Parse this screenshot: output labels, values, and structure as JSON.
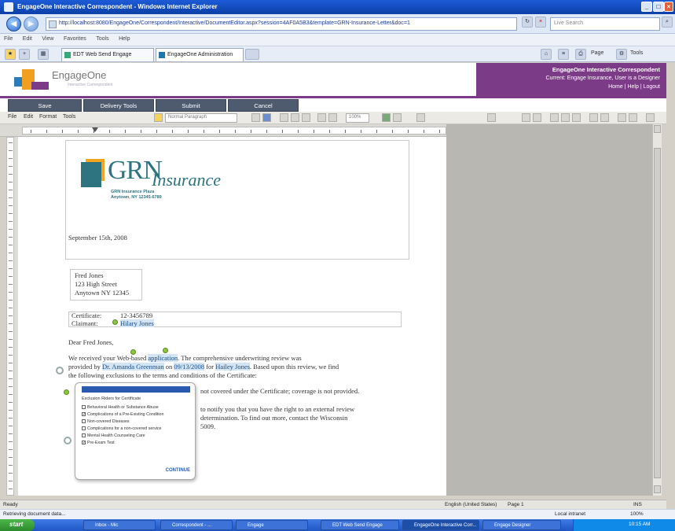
{
  "window": {
    "title": "EngageOne Interactive Correspondent - Windows Internet Explorer"
  },
  "browser": {
    "address": "http://localhost:8080/EngageOne/Correspondent/Interactive/DocumentEditor.aspx?session=4AF0A5B3&template=GRN-Insurance-Letter&doc=1",
    "search_placeholder": "Live Search",
    "menu": [
      "File",
      "Edit",
      "View",
      "Favorites",
      "Tools",
      "Help"
    ],
    "tabs": [
      {
        "label": "EDT Web Send Engage"
      },
      {
        "label": "EngageOne Administration"
      }
    ],
    "toolbar_labels": {
      "page": "Page",
      "tools": "Tools"
    }
  },
  "app": {
    "name": "EngageOne",
    "subtitle": "Interactive Correspondent",
    "banner_title": "EngageOne Interactive Correspondent",
    "banner_line2": "Current: Engage Insurance, User is a Designer",
    "banner_links": "Home | Help | Logout",
    "actions": [
      "Save",
      "Delivery Tools",
      "Submit",
      "Cancel"
    ]
  },
  "editor": {
    "menu": [
      "File",
      "Edit",
      "Format",
      "Tools"
    ],
    "style_select": "Normal Paragraph",
    "zoom": "100%"
  },
  "letter": {
    "brand_big": "GRN",
    "brand_small": "Insurance",
    "brand_addr1": "GRN Insurance Plaza",
    "brand_addr2": "Anytown, NY 12345-6789",
    "date": "September 15th, 2008",
    "recipient": [
      "Fred Jones",
      "123 High Street",
      "Anytown NY 12345"
    ],
    "certificate_label": "Certificate:",
    "certificate_value": "12-3456789",
    "claimant_label": "Claimant:",
    "claimant_value": "Hilary Jones",
    "salutation": "Dear Fred Jones,",
    "para1_a": "We received your Web-based",
    "para1_link": "application",
    "para1_b": ". The comprehensive underwriting review was",
    "para2_a": "provided by",
    "para2_link1": "Dr. Amanda Greenman",
    "para2_b": " on",
    "para2_link2": "09/13/2008",
    "para2_c": " for",
    "para2_link3": "Hailey Jones",
    "para2_d": ". Based upon this review, we find",
    "para3": "the following exclusions to the terms and conditions of the Certificate:",
    "para4": "not covered under the Certificate; coverage is not provided.",
    "para5": "to notify you that you have the right to an external review",
    "para6": "determination. To find out more, contact the Wisconsin",
    "para7": "5009."
  },
  "popup": {
    "title": "Exclusion Riders for Certificate",
    "options": [
      {
        "label": "Behavioral Health or Substance Abuse",
        "checked": false
      },
      {
        "label": "Complications of a Pre-Existing Condition",
        "checked": true
      },
      {
        "label": "Non-covered Diseases",
        "checked": false
      },
      {
        "label": "Complications for a non-covered service",
        "checked": false
      },
      {
        "label": "Mental Health Counseling Care",
        "checked": false
      },
      {
        "label": "Pre-Exam Test",
        "checked": true
      }
    ],
    "action": "CONTINUE"
  },
  "status": {
    "doc_left": "Ready",
    "doc_mode": "English (United States)",
    "doc_page": "Page 1",
    "doc_right": "INS",
    "ie_left": "Retrieving document data...",
    "ie_zone": "Local intranet",
    "ie_zoom": "100%"
  },
  "taskbar": {
    "start": "start",
    "tasks": [
      "Inbox - Mic",
      "Correspondent - ...",
      "Engage",
      "EDT Web Send Engage",
      "EngageOne Interactive Corr...",
      "Engage Designer"
    ],
    "clock": "10:15 AM"
  }
}
